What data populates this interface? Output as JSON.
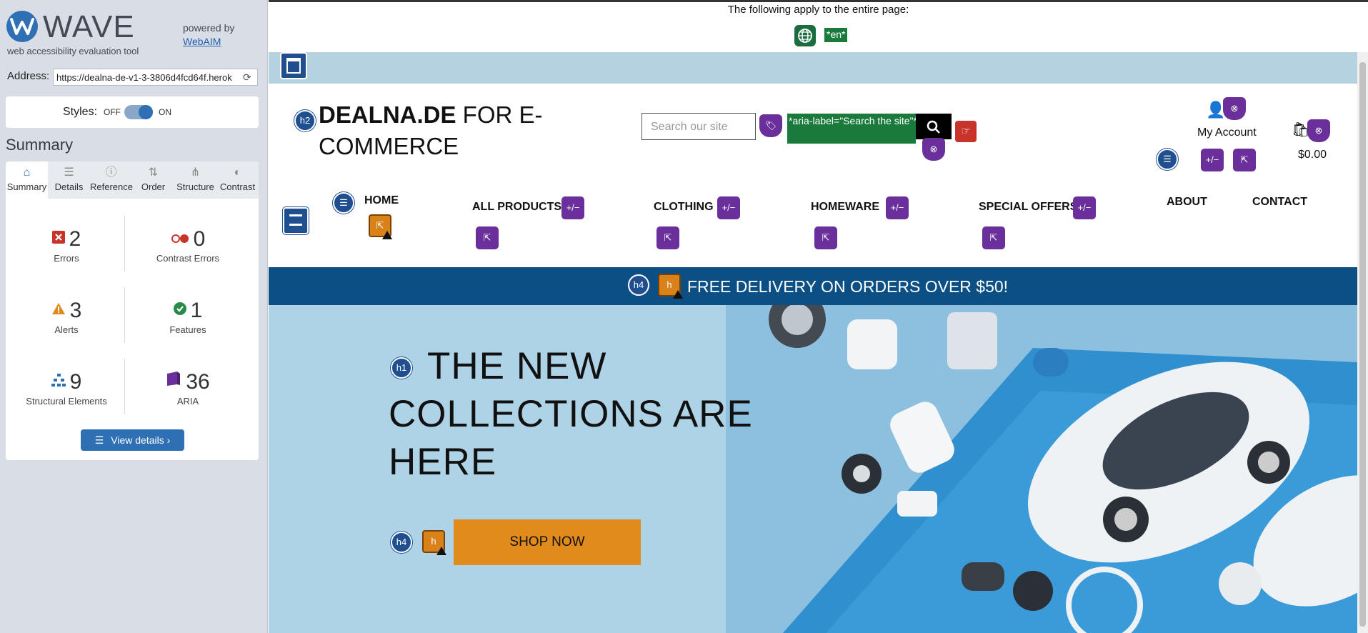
{
  "wave": {
    "title": "WAVE",
    "tagline": "web accessibility evaluation tool",
    "powered_by": "powered by",
    "webaim_link": "WebAIM",
    "address_label": "Address:",
    "address_value": "https://dealna-de-v1-3-3806d4fcd64f.herok",
    "styles_label": "Styles:",
    "styles_off": "OFF",
    "styles_on": "ON",
    "summary_heading": "Summary",
    "tabs": [
      {
        "label": "Summary",
        "icon": "home-icon"
      },
      {
        "label": "Details",
        "icon": "list-icon"
      },
      {
        "label": "Reference",
        "icon": "info-icon"
      },
      {
        "label": "Order",
        "icon": "order-icon"
      },
      {
        "label": "Structure",
        "icon": "structure-icon"
      },
      {
        "label": "Contrast",
        "icon": "contrast-icon"
      }
    ],
    "stats": {
      "errors": {
        "count": "2",
        "label": "Errors"
      },
      "contrast_errors": {
        "count": "0",
        "label": "Contrast Errors"
      },
      "alerts": {
        "count": "3",
        "label": "Alerts"
      },
      "features": {
        "count": "1",
        "label": "Features"
      },
      "structural": {
        "count": "9",
        "label": "Structural Elements"
      },
      "aria": {
        "count": "36",
        "label": "ARIA"
      }
    },
    "view_details": "View details ›"
  },
  "notice": {
    "text": "The following apply to the entire page:",
    "lang": "*en*"
  },
  "site": {
    "title_bold": "DEALNA.DE",
    "title_rest": " FOR E-COMMERCE",
    "search_placeholder": "Search our site",
    "aria_label_text": "*aria-label=\"Search the site\"*",
    "my_account": "My Account",
    "cart_total": "$0.00",
    "nav": [
      "HOME",
      "ALL PRODUCTS",
      "CLOTHING",
      "HOMEWARE",
      "SPECIAL OFFERS",
      "ABOUT",
      "CONTACT"
    ],
    "delivery": "FREE DELIVERY ON ORDERS OVER $50!",
    "hero_title": "THE NEW COLLECTIONS ARE HERE",
    "shop_now": "SHOP NOW",
    "markers": {
      "h1": "h1",
      "h2": "h2",
      "h4": "h4",
      "toggle": "+/−",
      "h": "h"
    }
  },
  "colors": {
    "wave_blue": "#2f6fb3",
    "aria_purple": "#6a2f9a",
    "alert_orange": "#d9821a",
    "delivery_blue": "#0c4f85",
    "shop_orange": "#e08b1c"
  }
}
